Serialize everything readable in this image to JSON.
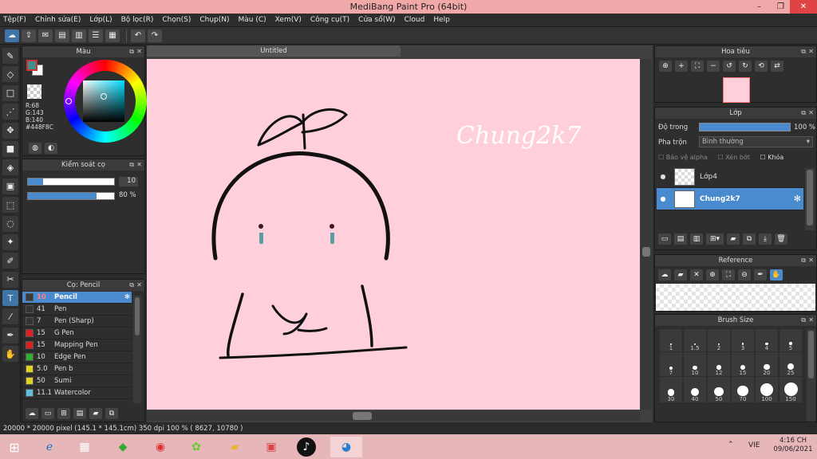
{
  "window": {
    "title": "MediBang Paint Pro (64bit)",
    "minimize": "–",
    "maximize": "❐",
    "close": "✕"
  },
  "menu": [
    "Tệp(F)",
    "Chỉnh sửa(E)",
    "Lớp(L)",
    "Bộ lọc(R)",
    "Chọn(S)",
    "Chụp(N)",
    "Màu (C)",
    "Xem(V)",
    "Công cụ(T)",
    "Cửa sổ(W)",
    "Cloud",
    "Help"
  ],
  "color_panel": {
    "title": "Màu",
    "r": "R:68",
    "g": "G:143",
    "b": "B:140",
    "hex": "#448F8C",
    "fg": "#448F8C",
    "bg": "#ffffff"
  },
  "control_panel": {
    "title": "Kiểm soát cọ",
    "size_value": "10",
    "opacity_value": "80 %",
    "size_fraction": 0.18,
    "opacity_fraction": 0.8
  },
  "brush_panel": {
    "title": "Cọ: Pencil",
    "items": [
      {
        "size": "10",
        "name": "Pencil",
        "color": "#3a3a3a",
        "selected": true
      },
      {
        "size": "41",
        "name": "Pen",
        "color": "#333333",
        "selected": false
      },
      {
        "size": "7",
        "name": "Pen (Sharp)",
        "color": "#333333",
        "selected": false
      },
      {
        "size": "15",
        "name": "G Pen",
        "color": "#e02020",
        "selected": false
      },
      {
        "size": "15",
        "name": "Mapping Pen",
        "color": "#e02020",
        "selected": false
      },
      {
        "size": "10",
        "name": "Edge Pen",
        "color": "#30b030",
        "selected": false
      },
      {
        "size": "5.0",
        "name": "Pen b",
        "color": "#e0d020",
        "selected": false
      },
      {
        "size": "50",
        "name": "Sumi",
        "color": "#e0d020",
        "selected": false
      },
      {
        "size": "11.1",
        "name": "Watercolor",
        "color": "#60c0e0",
        "selected": false
      }
    ]
  },
  "document": {
    "tab": "Untitled",
    "canvas_text": "Chung2k7"
  },
  "navigator": {
    "title": "Hoa tiêu"
  },
  "layer_panel": {
    "title": "Lớp",
    "opacity_label": "Độ trong",
    "opacity_value": "100 %",
    "blend_label": "Pha trộn",
    "blend_value": "Bình thường",
    "protect_alpha": "Bảo vệ alpha",
    "clipping": "Xén bớt",
    "lock": "Khóa",
    "layers": [
      {
        "name": "Lớp4",
        "selected": false
      },
      {
        "name": "Chung2k7",
        "selected": true
      }
    ]
  },
  "reference_panel": {
    "title": "Reference"
  },
  "brush_size_panel": {
    "title": "Brush Size",
    "sizes": [
      "1",
      "1.5",
      "2",
      "3",
      "4",
      "5",
      "7",
      "10",
      "12",
      "15",
      "20",
      "25",
      "30",
      "40",
      "50",
      "70",
      "100",
      "150"
    ]
  },
  "status": {
    "text": "20000 * 20000 pixel   (145.1 * 145.1cm)   350 dpi   100 %   ( 8627, 10780 )"
  },
  "taskbar": {
    "lang": "VIE",
    "time": "4:16 CH",
    "date": "09/06/2021"
  }
}
